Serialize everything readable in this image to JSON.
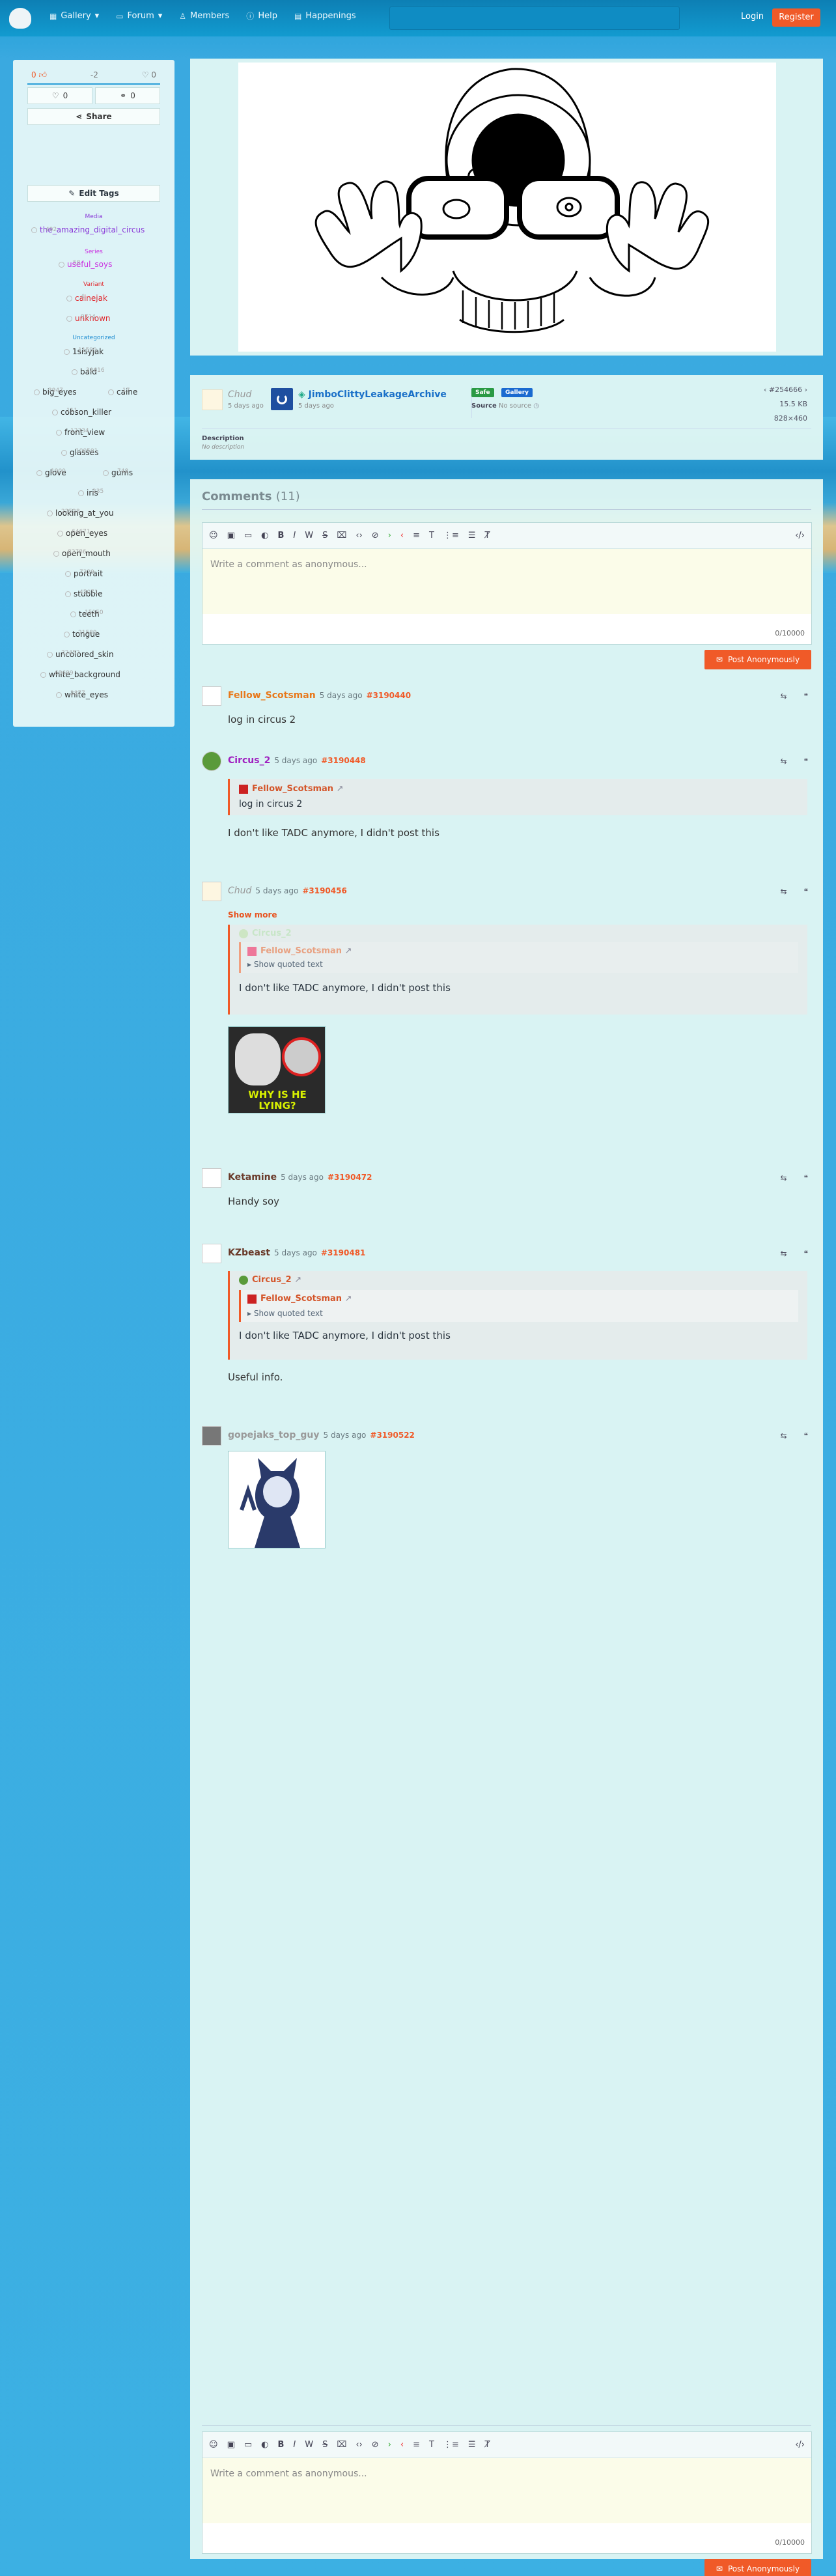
{
  "nav": {
    "gallery": "Gallery",
    "forum": "Forum",
    "members": "Members",
    "help": "Help",
    "happenings": "Happenings",
    "login": "Login",
    "register": "Register"
  },
  "votes": {
    "up": "0",
    "score": "-2",
    "fav": "0",
    "tags": "0",
    "comments": "0",
    "share": "Share",
    "edit_tags": "Edit Tags"
  },
  "tags": {
    "media_label": "Media",
    "media": [
      {
        "name": "the_amazing_digital_circus",
        "count": "492"
      }
    ],
    "series_label": "Series",
    "series": [
      {
        "name": "useful_soys",
        "count": "58"
      }
    ],
    "variant_label": "Variant",
    "variant": [
      {
        "name": "cainejak",
        "count": "4"
      },
      {
        "name": "unknown",
        "count": "9714"
      }
    ],
    "unc_label": "Uncategorized",
    "general": [
      {
        "name": "1sisyjak",
        "count": "11590"
      },
      {
        "name": "bald",
        "count": "30616"
      },
      {
        "name": "big_eyes",
        "count": "3947"
      },
      {
        "name": "caine",
        "count": "17"
      },
      {
        "name": "cobson_killer",
        "count": "111"
      },
      {
        "name": "front_view",
        "count": "12334"
      },
      {
        "name": "glasses",
        "count": "100501"
      },
      {
        "name": "glove",
        "count": "1900"
      },
      {
        "name": "gums",
        "count": "748"
      },
      {
        "name": "iris",
        "count": "235"
      },
      {
        "name": "looking_at_you",
        "count": "22528"
      },
      {
        "name": "open_eyes",
        "count": "64671"
      },
      {
        "name": "open_mouth",
        "count": "82786"
      },
      {
        "name": "portrait",
        "count": "7229"
      },
      {
        "name": "stubble",
        "count": "45071"
      },
      {
        "name": "teeth",
        "count": "15150"
      },
      {
        "name": "tongue",
        "count": "21589"
      },
      {
        "name": "uncolored_skin",
        "count": "32452"
      },
      {
        "name": "white_background",
        "count": "69699"
      },
      {
        "name": "white_eyes",
        "count": "2877"
      }
    ]
  },
  "info": {
    "uploader": "Chud",
    "uploader_time": "5 days ago",
    "approver": "JimboClittyLeakageArchive",
    "approver_time": "5 days ago",
    "rating": "Safe",
    "pool": "Gallery",
    "source_label": "Source",
    "source": "No source",
    "id": "#254666",
    "size": "15.5 KB",
    "dims": "828×460",
    "desc_label": "Description",
    "desc": "No description"
  },
  "comments_title": "Comments",
  "comments_count": "(11)",
  "editor": {
    "placeholder": "Write a comment as anonymous...",
    "counter": "0/10000",
    "post": "Post Anonymously"
  },
  "comments": [
    {
      "name": "Fellow_Scotsman",
      "time": "5 days ago",
      "id": "#3190440",
      "body": "log in circus 2"
    },
    {
      "name": "Circus_2",
      "time": "5 days ago",
      "id": "#3190448",
      "quote_name": "Fellow_Scotsman",
      "quote_text": "log in circus 2",
      "body": "I don't like TADC anymore, I didn't post this"
    },
    {
      "name": "Chud",
      "time": "5 days ago",
      "id": "#3190456",
      "show_more": "Show more",
      "q1": "Circus_2",
      "q2": "Fellow_Scotsman",
      "showq": "Show quoted text",
      "qbody": "I don't like TADC anymore, I didn't post this",
      "img_text": "WHY IS HE LYING?"
    },
    {
      "name": "Ketamine",
      "time": "5 days ago",
      "id": "#3190472",
      "body": "Handy soy"
    },
    {
      "name": "KZbeast",
      "time": "5 days ago",
      "id": "#3190481",
      "q1": "Circus_2",
      "q2": "Fellow_Scotsman",
      "showq": "Show quoted text",
      "qbody": "I don't like TADC anymore, I didn't post this",
      "body": "Useful info."
    },
    {
      "name": "gopejaks_top_guy",
      "time": "5 days ago",
      "id": "#3190522"
    }
  ]
}
